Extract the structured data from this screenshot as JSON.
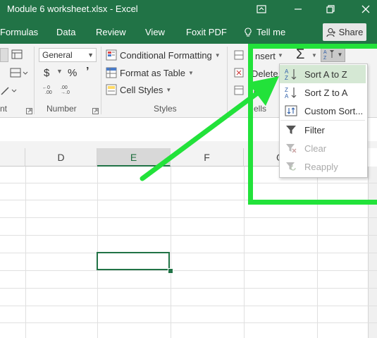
{
  "window": {
    "title": "Module 6 worksheet.xlsx  -  Excel"
  },
  "tabs": [
    "Formulas",
    "Data",
    "Review",
    "View",
    "Foxit PDF",
    "Tell me",
    "Share"
  ],
  "ribbon": {
    "number_format": "General",
    "percent_symbol": "%",
    "comma_symbol": "’",
    "currency_symbol": "$",
    "conditional_formatting": "Conditional Formatting",
    "format_as_table": "Format as Table",
    "cell_styles": "Cell Styles",
    "insert": "nsert",
    "delete": "Delete",
    "format": "or",
    "groups": {
      "alignment": "nt",
      "number": "Number",
      "styles": "Styles",
      "cells": "ells"
    }
  },
  "grid": {
    "columns": [
      "D",
      "E",
      "F",
      "G"
    ],
    "selected_column": "E"
  },
  "sort_filter_menu": {
    "items": [
      {
        "label": "Sort A to Z",
        "icon": "sort-a-to-z-icon",
        "enabled": true
      },
      {
        "label": "Sort Z to A",
        "icon": "sort-z-to-a-icon",
        "enabled": true
      },
      {
        "label": "Custom Sort...",
        "icon": "custom-sort-icon",
        "enabled": true
      },
      {
        "label": "Filter",
        "icon": "filter-icon",
        "enabled": true
      },
      {
        "label": "Clear",
        "icon": "clear-filter-icon",
        "enabled": false
      },
      {
        "label": "Reapply",
        "icon": "reapply-icon",
        "enabled": false
      }
    ]
  },
  "colors": {
    "excel_green": "#217346",
    "highlight_green": "#22e23a"
  }
}
